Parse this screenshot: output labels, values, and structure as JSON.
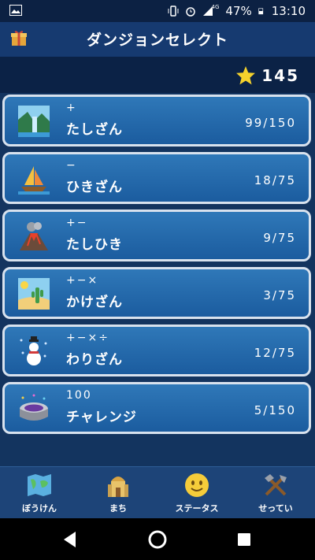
{
  "status_bar": {
    "network": "4G",
    "battery": "47%",
    "time": "13:10"
  },
  "header": {
    "title": "ダンジョンセレクト"
  },
  "stars": {
    "count": "145"
  },
  "dungeons": [
    {
      "ops": "+",
      "name": "たしざん",
      "score": "99/150",
      "icon": "waterfall-icon"
    },
    {
      "ops": "−",
      "name": "ひきざん",
      "score": "18/75",
      "icon": "sailboat-icon"
    },
    {
      "ops": "+−",
      "name": "たしひき",
      "score": "9/75",
      "icon": "volcano-icon"
    },
    {
      "ops": "+−×",
      "name": "かけざん",
      "score": "3/75",
      "icon": "desert-icon"
    },
    {
      "ops": "+−×÷",
      "name": "わりざん",
      "score": "12/75",
      "icon": "snowman-icon"
    },
    {
      "ops": "100",
      "name": "チャレンジ",
      "score": "5/150",
      "icon": "stadium-icon"
    }
  ],
  "bottom_nav": [
    {
      "label": "ぼうけん",
      "icon": "map-icon"
    },
    {
      "label": "まち",
      "icon": "town-icon"
    },
    {
      "label": "ステータス",
      "icon": "smiley-icon"
    },
    {
      "label": "せってい",
      "icon": "tools-icon"
    }
  ]
}
